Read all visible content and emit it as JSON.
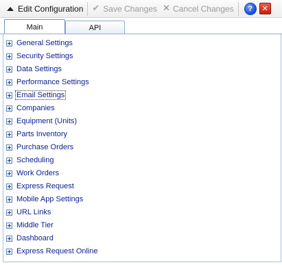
{
  "toolbar": {
    "edit_label": "Edit Configuration",
    "save_label": "Save Changes",
    "cancel_label": "Cancel Changes",
    "help_glyph": "?",
    "close_glyph": "✕"
  },
  "tabs": [
    {
      "label": "Main",
      "active": true
    },
    {
      "label": "API",
      "active": false
    }
  ],
  "tree": {
    "items": [
      {
        "label": "General Settings"
      },
      {
        "label": "Security Settings"
      },
      {
        "label": "Data Settings"
      },
      {
        "label": "Performance Settings"
      },
      {
        "label": "Email Settings",
        "focused": true
      },
      {
        "label": "Companies"
      },
      {
        "label": "Equipment (Units)"
      },
      {
        "label": "Parts Inventory"
      },
      {
        "label": "Purchase Orders"
      },
      {
        "label": "Scheduling"
      },
      {
        "label": "Work Orders"
      },
      {
        "label": "Express Request"
      },
      {
        "label": "Mobile App Settings"
      },
      {
        "label": "URL Links"
      },
      {
        "label": "Middle Tier"
      },
      {
        "label": "Dashboard"
      },
      {
        "label": "Express Request Online"
      }
    ]
  }
}
